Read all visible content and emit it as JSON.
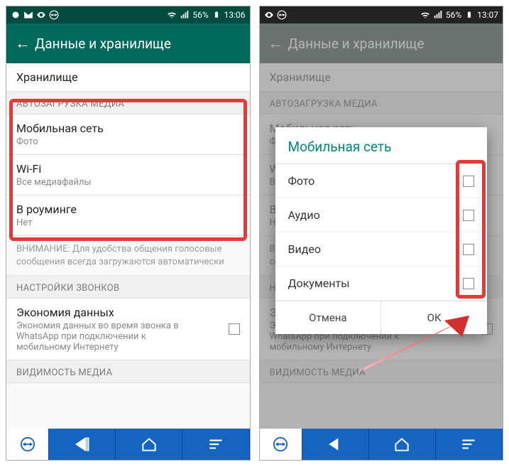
{
  "left": {
    "status": {
      "battery": "56%",
      "time": "13:06"
    },
    "appbar_title": "Данные и хранилище",
    "storage": "Хранилище",
    "section_autoload": "АВТОЗАГРУЗКА МЕДИА",
    "mobile": {
      "title": "Мобильная сеть",
      "sub": "Фото"
    },
    "wifi": {
      "title": "Wi-Fi",
      "sub": "Все медиафайлы"
    },
    "roaming": {
      "title": "В роуминге",
      "sub": "Нет"
    },
    "note": "ВНИМАНИЕ: Для удобства общения голосовые сообщения всегда загружаются автоматически",
    "section_calls": "НАСТРОЙКИ ЗВОНКОВ",
    "economy": {
      "title": "Экономия данных",
      "sub": "Экономия данных во время звонка в WhatsApp при подключении к мобильному Интернету"
    },
    "section_visibility": "ВИДИМОСТЬ МЕДИА"
  },
  "right": {
    "status": {
      "battery": "56%",
      "time": "13:07"
    },
    "appbar_title": "Данные и хранилище",
    "dialog_title": "Мобильная сеть",
    "opts": {
      "photo": "Фото",
      "audio": "Аудио",
      "video": "Видео",
      "docs": "Документы"
    },
    "cancel": "Отмена",
    "ok": "ОК"
  }
}
